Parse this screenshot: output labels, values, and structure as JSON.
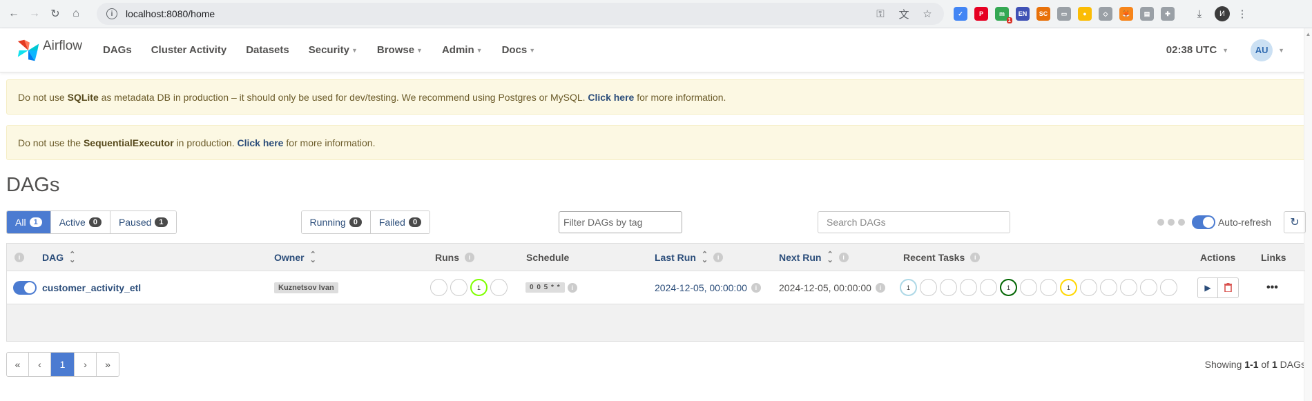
{
  "browser": {
    "url": "localhost:8080/home",
    "profile_initial": "И",
    "extensions": [
      {
        "name": "ext-blue-check",
        "color": "#4285f4",
        "text": "✓"
      },
      {
        "name": "pinterest-icon",
        "color": "#e60023",
        "text": "P"
      },
      {
        "name": "ext-green-counter",
        "color": "#34a853",
        "text": "m",
        "badge": "1"
      },
      {
        "name": "ext-en-translator",
        "color": "#3f51b5",
        "text": "EN"
      },
      {
        "name": "ext-sc",
        "color": "#e8710a",
        "text": "SC"
      },
      {
        "name": "ext-window",
        "color": "#9aa0a6",
        "text": "▭"
      },
      {
        "name": "ext-yellow",
        "color": "#fbbc04",
        "text": "●"
      },
      {
        "name": "ext-shield",
        "color": "#9aa0a6",
        "text": "◇"
      },
      {
        "name": "metamask-icon",
        "color": "#f6851b",
        "text": "🦊"
      },
      {
        "name": "ext-doc",
        "color": "#9aa0a6",
        "text": "▤"
      },
      {
        "name": "extensions-puzzle",
        "color": "#9aa0a6",
        "text": "✚"
      }
    ]
  },
  "nav": {
    "brand": "Airflow",
    "items": [
      {
        "label": "DAGs",
        "dropdown": false
      },
      {
        "label": "Cluster Activity",
        "dropdown": false
      },
      {
        "label": "Datasets",
        "dropdown": false
      },
      {
        "label": "Security",
        "dropdown": true
      },
      {
        "label": "Browse",
        "dropdown": true
      },
      {
        "label": "Admin",
        "dropdown": true
      },
      {
        "label": "Docs",
        "dropdown": true
      }
    ],
    "clock": "02:38 UTC",
    "user_initials": "AU"
  },
  "alerts": {
    "sqlite": {
      "pre": "Do not use ",
      "bold": "SQLite",
      "mid": " as metadata DB in production – it should only be used for dev/testing. We recommend using Postgres or MySQL. ",
      "link": "Click here",
      "post": " for more information."
    },
    "executor": {
      "pre": "Do not use the ",
      "bold": "SequentialExecutor",
      "mid": " in production. ",
      "link": "Click here",
      "post": " for more information."
    }
  },
  "page": {
    "title": "DAGs"
  },
  "filters": {
    "status": [
      {
        "label": "All",
        "count": "1",
        "active": true
      },
      {
        "label": "Active",
        "count": "0",
        "active": false
      },
      {
        "label": "Paused",
        "count": "1",
        "active": false
      }
    ],
    "runs": [
      {
        "label": "Running",
        "count": "0"
      },
      {
        "label": "Failed",
        "count": "0"
      }
    ],
    "tag_placeholder": "Filter DAGs by tag",
    "search_placeholder": "Search DAGs",
    "auto_refresh_label": "Auto-refresh"
  },
  "table": {
    "headers": {
      "dag": "DAG",
      "owner": "Owner",
      "runs": "Runs",
      "schedule": "Schedule",
      "last_run": "Last Run",
      "next_run": "Next Run",
      "recent_tasks": "Recent Tasks",
      "actions": "Actions",
      "links": "Links"
    },
    "rows": [
      {
        "dag_id": "customer_activity_etl",
        "owner": "Kuznetsov Ivan",
        "runs": [
          {
            "count": "",
            "color": "#cccccc"
          },
          {
            "count": "",
            "color": "#cccccc"
          },
          {
            "count": "1",
            "color": "#7fff00"
          },
          {
            "count": "",
            "color": "#cccccc"
          }
        ],
        "schedule": "0 0 5 * *",
        "last_run": "2024-12-05, 00:00:00",
        "next_run": "2024-12-05, 00:00:00",
        "recent_tasks": [
          {
            "count": "1",
            "color": "#add8e6"
          },
          {
            "count": "",
            "color": "#cccccc"
          },
          {
            "count": "",
            "color": "#cccccc"
          },
          {
            "count": "",
            "color": "#cccccc"
          },
          {
            "count": "",
            "color": "#cccccc"
          },
          {
            "count": "1",
            "color": "#006400"
          },
          {
            "count": "",
            "color": "#cccccc"
          },
          {
            "count": "",
            "color": "#cccccc"
          },
          {
            "count": "1",
            "color": "#ffd700"
          },
          {
            "count": "",
            "color": "#cccccc"
          },
          {
            "count": "",
            "color": "#cccccc"
          },
          {
            "count": "",
            "color": "#cccccc"
          },
          {
            "count": "",
            "color": "#cccccc"
          },
          {
            "count": "",
            "color": "#cccccc"
          }
        ]
      }
    ]
  },
  "pagination": {
    "first": "«",
    "prev": "‹",
    "current": "1",
    "next": "›",
    "last": "»",
    "showing_pre": "Showing ",
    "showing_range": "1-1",
    "showing_mid": " of ",
    "showing_total": "1",
    "showing_post": " DAGs"
  },
  "colors": {
    "accent": "#4b7bd1",
    "link": "#2b4d7a",
    "alert_bg": "#fcf8e3",
    "delete": "#d9534f",
    "trigger": "#2b4d7a"
  }
}
